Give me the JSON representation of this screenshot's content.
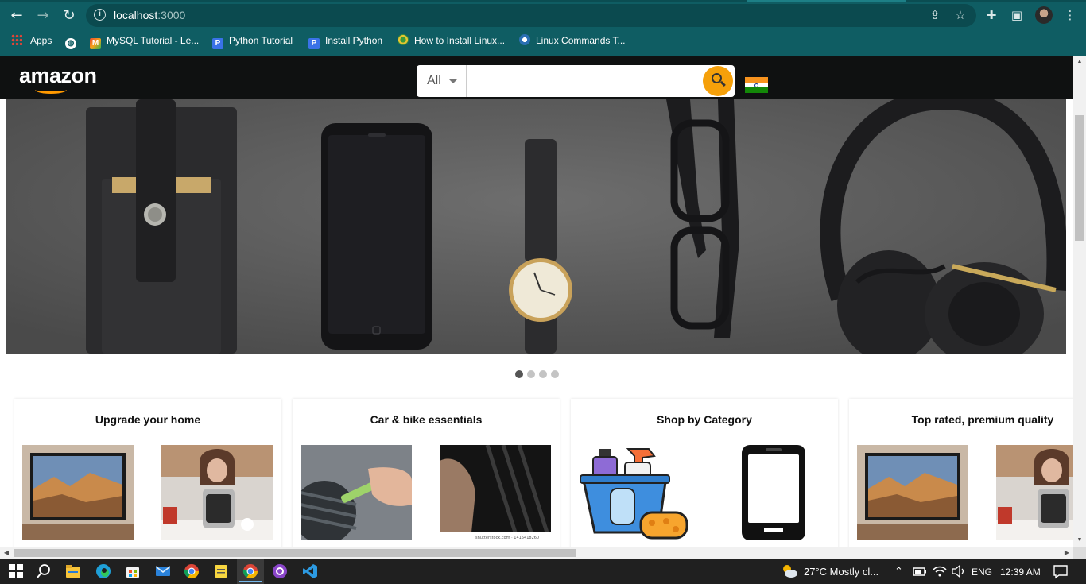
{
  "browser": {
    "url_host": "localhost",
    "url_port": ":3000",
    "bookmarks": [
      {
        "label": "Apps",
        "icon": "apps-grid-icon"
      },
      {
        "label": "",
        "icon": "globe-icon"
      },
      {
        "label": "MySQL Tutorial - Le...",
        "icon": "mysql-tutorial-icon"
      },
      {
        "label": "Python Tutorial",
        "icon": "p-badge-icon"
      },
      {
        "label": "Install Python",
        "icon": "p-badge-icon"
      },
      {
        "label": "How to Install Linux...",
        "icon": "linux-site-icon"
      },
      {
        "label": "Linux Commands T...",
        "icon": "linux-commands-icon"
      }
    ]
  },
  "header": {
    "logo_text": "amazon",
    "search": {
      "category": "All",
      "placeholder": ""
    },
    "flag": "india-flag-icon"
  },
  "carousel": {
    "slide_count": 4,
    "active_index": 0
  },
  "cards": [
    {
      "title": "Upgrade your home",
      "images": [
        "tv-image",
        "pressure-cooker-image"
      ]
    },
    {
      "title": "Car & bike essentials",
      "images": [
        "car-vent-cleaning-image",
        "tyre-image"
      ]
    },
    {
      "title": "Shop by Category",
      "images": [
        "cleaning-supplies-icon",
        "smartphone-icon"
      ]
    },
    {
      "title": "Top rated, premium quality",
      "images": [
        "tv-image",
        "pressure-cooker-image"
      ]
    }
  ],
  "small_caption": "shutterstock.com · 1415418260",
  "taskbar": {
    "weather": "27°C  Mostly cl...",
    "language": "ENG",
    "time": "12:39 AM"
  },
  "colors": {
    "chrome": "#0f5d63",
    "header": "#0f1111",
    "search_button": "#f5a00a",
    "logo_smile": "#ff9900"
  }
}
